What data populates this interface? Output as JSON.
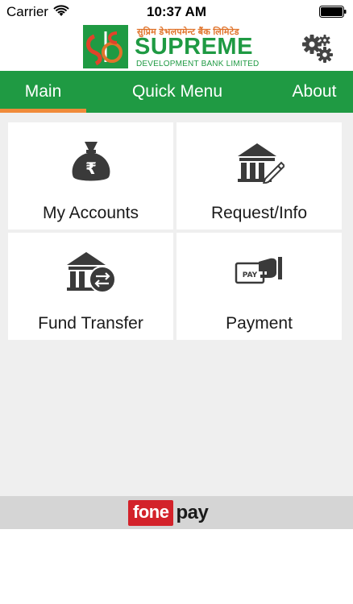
{
  "status_bar": {
    "carrier": "Carrier",
    "time": "10:37 AM",
    "wifi_icon": "wifi-icon",
    "battery_icon": "battery-icon"
  },
  "header": {
    "logo_devanagari": "सुप्रिम डेभलपमेन्ट बैंक लिमिटेड",
    "logo_name": "SUPREME",
    "logo_subtitle": "DEVELOPMENT BANK LIMITED",
    "settings_icon": "gears-icon"
  },
  "tabs": [
    {
      "label": "Main",
      "active": true
    },
    {
      "label": "Quick Menu",
      "active": false
    },
    {
      "label": "About",
      "active": false
    }
  ],
  "menu": [
    {
      "label": "My Accounts",
      "icon": "money-bag-icon"
    },
    {
      "label": "Request/Info",
      "icon": "bank-edit-icon"
    },
    {
      "label": "Fund Transfer",
      "icon": "bank-transfer-icon"
    },
    {
      "label": "Payment",
      "icon": "pay-card-icon"
    }
  ],
  "footer": {
    "brand_fone": "fone",
    "brand_pay": "pay"
  },
  "colors": {
    "brand_green": "#1f9a43",
    "tab_indicator": "#f08a3a",
    "fonepay_red": "#d3222a",
    "background": "#efefef"
  }
}
